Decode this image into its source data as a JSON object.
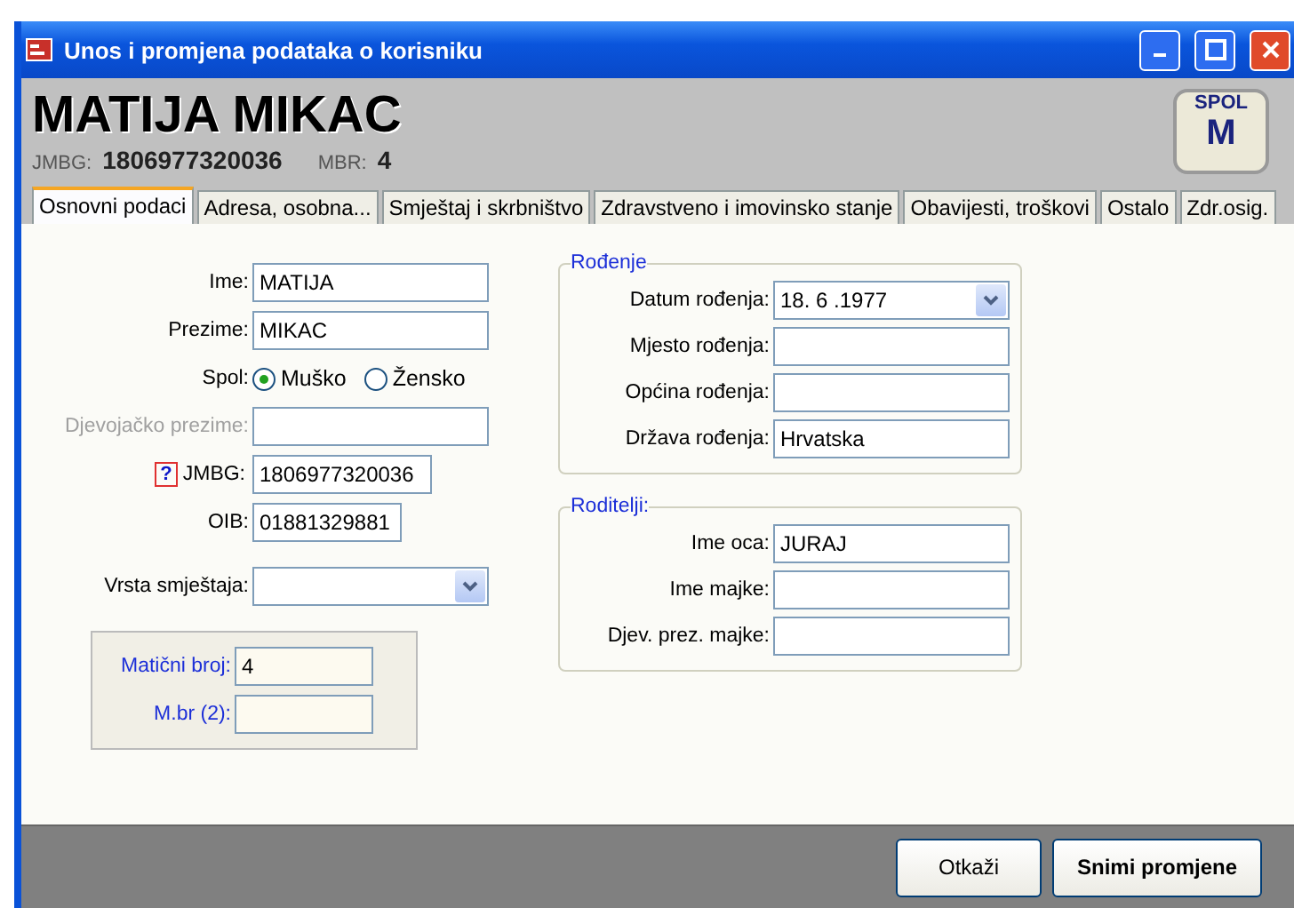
{
  "window": {
    "title": "Unos i promjena podataka o korisniku"
  },
  "header": {
    "name": "MATIJA MIKAC",
    "jmbg_label": "JMBG:",
    "jmbg": "1806977320036",
    "mbr_label": "MBR:",
    "mbr": "4",
    "gender_label": "SPOL",
    "gender": "M"
  },
  "tabs": [
    {
      "label": "Osnovni podaci",
      "selected": true
    },
    {
      "label": "Adresa, osobna...",
      "selected": false
    },
    {
      "label": "Smještaj i skrbništvo",
      "selected": false
    },
    {
      "label": "Zdravstveno i imovinsko stanje",
      "selected": false
    },
    {
      "label": "Obavijesti, troškovi",
      "selected": false
    },
    {
      "label": "Ostalo",
      "selected": false
    },
    {
      "label": "Zdr.osig.",
      "selected": false
    }
  ],
  "personal": [
    {
      "kind": "text",
      "label": "Ime:",
      "value": "MATIJA",
      "disabled": false
    },
    {
      "kind": "text",
      "label": "Prezime:",
      "value": "MIKAC",
      "disabled": false
    },
    {
      "kind": "radio",
      "label": "Spol:",
      "options": [
        {
          "label": "Muško",
          "selected": true
        },
        {
          "label": "Žensko",
          "selected": false
        }
      ]
    },
    {
      "kind": "text",
      "label": "Djevojačko prezime:",
      "disabled": true
    },
    {
      "kind": "help",
      "help": "?",
      "label": "JMBG:",
      "value": "1806977320036",
      "disabled": false
    },
    {
      "kind": "code",
      "label": "OIB:",
      "value": "01881329881",
      "disabled": false
    },
    {
      "kind": "spacer"
    },
    {
      "kind": "select",
      "label": "Vrsta smještaja:"
    }
  ],
  "registry": [
    {
      "label": "Matični broj:",
      "value": "4"
    },
    {
      "label": "M.br (2):"
    }
  ],
  "groups": [
    {
      "title": "Rođenje",
      "fields": [
        {
          "kind": "select",
          "label": "Datum rođenja:",
          "value": "18. 6 .1977"
        },
        {
          "kind": "text",
          "label": "Mjesto rođenja:"
        },
        {
          "kind": "text",
          "label": "Općina rođenja:"
        },
        {
          "kind": "text",
          "label": "Država rođenja:",
          "value": "Hrvatska"
        }
      ]
    },
    {
      "title": "Roditelji:",
      "fields": [
        {
          "kind": "text",
          "label": "Ime oca:",
          "value": "JURAJ"
        },
        {
          "kind": "text",
          "label": "Ime majke:"
        },
        {
          "kind": "text",
          "label": "Djev. prez. majke:"
        }
      ]
    }
  ],
  "buttons": [
    {
      "label": "Otkaži",
      "primary": false
    },
    {
      "label": "Snimi promjene",
      "primary": true
    }
  ]
}
